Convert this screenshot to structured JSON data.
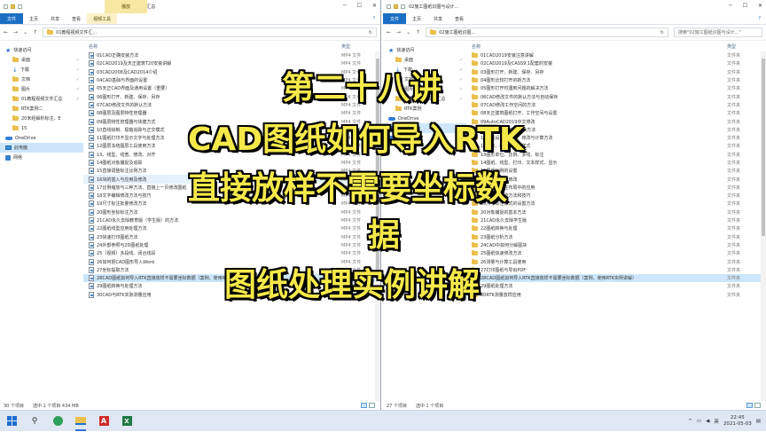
{
  "left_window": {
    "title": "01教程视频文件汇总",
    "context_tab_header": "播放",
    "ribbon": {
      "file": "文件",
      "home": "主页",
      "share": "共享",
      "view": "查看",
      "context": "视频工具",
      "help": "?"
    },
    "address": "01教程视频文件汇...",
    "nav_items": [
      {
        "label": "快速访问",
        "icon": "star-icon"
      },
      {
        "label": "桌面",
        "icon": "folder-icon"
      },
      {
        "label": "下载",
        "icon": "download-icon"
      },
      {
        "label": "文档",
        "icon": "folder-icon"
      },
      {
        "label": "图片",
        "icon": "folder-icon"
      },
      {
        "label": "01教程视频文件汇总",
        "icon": "folder-icon"
      },
      {
        "label": "RTK案例二",
        "icon": "folder-icon"
      },
      {
        "label": "20未经解析标注、E",
        "icon": "folder-icon"
      },
      {
        "label": "15",
        "icon": "folder-icon"
      },
      {
        "label": "OneDrive",
        "icon": "cloud-icon"
      },
      {
        "label": "此电脑",
        "icon": "pc-icon"
      },
      {
        "label": "网络",
        "icon": "network-icon"
      }
    ],
    "col_name": "名称",
    "col_type": "类型",
    "files": [
      "01CAD正确安装方法",
      "02CAD2019及天正建筑T20安装讲解",
      "03CAD2008及CAD2014介绍",
      "04CAD基础与界面的设置",
      "05天正CAD界面及通用设置（重要）",
      "06图形打开、新建、保存、另存",
      "07CAD修改文件的默认方法",
      "08图层及图层特性管理器",
      "09图层特性管理器与快捷方式",
      "10直线绘制、极轴追踪与正交模式",
      "11图纸打印不显示文字与处理方法",
      "12图层冻结图层工具使用方法",
      "13、线型、线宽、修改、对齐",
      "14图纸对象捕捉及追踪",
      "15直接调整标注比例方法",
      "16块的插入与应用及修改",
      "17比例缩放与三种方法、直接上一页修改图纸",
      "18文字编辑修改方法与技巧",
      "19尺寸标注批量修改方法",
      "20图形坐标标注方法",
      "21CAD永久去除教育版（学生版）的方法",
      "22图纸线型应用处理方法",
      "23快速打印图纸方法",
      "24外部参照与2D图纸处理",
      "25（视频）多段线、闭合线段",
      "26如何把CAD图形导入Word",
      "27坐标提取方法",
      "28CAD图纸如何导入RTK直接放样不需要坐标数据（案例、使用RTK实例讲解）",
      "29图纸转换与处理方法",
      "30CAD与RTK实际测量应用"
    ],
    "file_type": "MP4 文件",
    "selected_index": 27,
    "highlight_index": 15,
    "status_count": "30 个项目",
    "status_selected": "选中 1 个项目  434 MB"
  },
  "right_window": {
    "title": "02施工图纸识图与设计...",
    "ribbon": {
      "file": "文件",
      "home": "主页",
      "share": "共享",
      "view": "查看",
      "help": "?"
    },
    "address": "02施工图纸识图...",
    "search_placeholder": "搜索\"02施工图纸识图与设计...\"",
    "nav_items": [
      {
        "label": "快速访问",
        "icon": "star-icon"
      },
      {
        "label": "桌面",
        "icon": "folder-icon"
      },
      {
        "label": "下载",
        "icon": "download-icon"
      },
      {
        "label": "文档",
        "icon": "folder-icon"
      },
      {
        "label": "图片",
        "icon": "folder-icon"
      },
      {
        "label": "01教程视频文件汇总",
        "icon": "folder-icon"
      },
      {
        "label": "RTK案例",
        "icon": "folder-icon"
      },
      {
        "label": "OneDrive",
        "icon": "cloud-icon"
      },
      {
        "label": "此电脑",
        "icon": "pc-icon"
      },
      {
        "label": "网络",
        "icon": "network-icon"
      }
    ],
    "col_name": "名称",
    "col_type": "类型",
    "files": [
      "01CAD2019安装注意讲解",
      "02CAD2019及CASS9.1配套的安装",
      "03图形打开、新建、保存、另存",
      "04图形比较打开的新方法",
      "05图形打开时遇到问题的解决方法",
      "06CAD修改文件的默认方法与自动保存",
      "07CAD修改工作空间的方法",
      "08天正建筑图纸打开、工作空间与设置",
      "09AutoCAD2019中文修改",
      "10CAD图纸坐标系转换方法",
      "11图纸设置、绘图、修改与计算方法",
      "12坐标、线型、文本样式",
      "13图形单位、比例、多线、标注",
      "14图纸、线型、打印、文本样式、显示",
      "15图纸比例的设置",
      "16图形线宽的修改",
      "17图纸比例在布局中的应用",
      "18文字的修改方法和技巧",
      "19尺寸标注样式的设置方法",
      "20对象捕捉的基本方法",
      "21CAD永久去除学生版",
      "22图纸转换与处理",
      "23图纸分析方法",
      "24CAD中如何分解图块",
      "25图纸快速修改方法",
      "26测量与计算工具使用",
      "27打印图纸与导出PDF",
      "28CAD图纸如何导入RTK直接放样不需要坐标数据（案例、使用RTK实例讲解）",
      "29图纸处理方法",
      "30RTK测量放样应用"
    ],
    "file_type": "文件夹",
    "selected_index": 27,
    "status_count": "27 个项目",
    "status_selected": "选中 1 个项目"
  },
  "overlay": {
    "line1": "第二十八讲",
    "line2": "CAD图纸如何导入RTK",
    "line3": "直接放样不需要坐标数",
    "line4": "据",
    "line5": "图纸处理实例讲解"
  },
  "taskbar": {
    "ime": "英",
    "time": "22:45",
    "date": "2021-05-03",
    "tray_caret": "^",
    "app_label": "A"
  },
  "colors": {
    "overlay_text": "#f5e94a",
    "accent": "#1a6fc4",
    "selection": "#cde6fb"
  }
}
